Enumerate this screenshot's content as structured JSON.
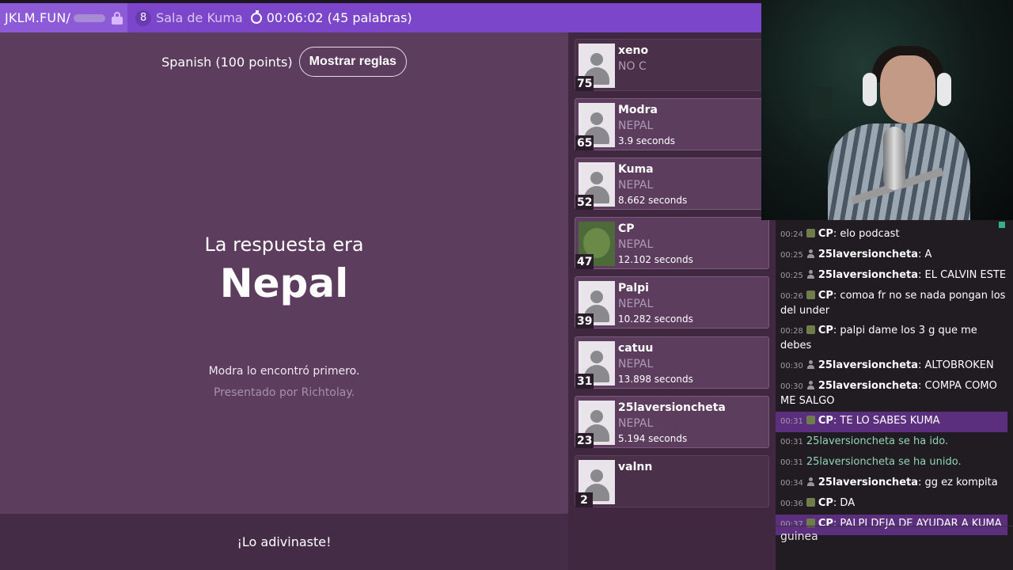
{
  "topbar": {
    "site": "JKLM.FUN/",
    "room_count": "8",
    "room_name": "Sala de Kuma",
    "timer": "00:06:02 (45 palabras)"
  },
  "main": {
    "language": "Spanish (100 points)",
    "rules_button": "Mostrar reglas",
    "answer_label": "La respuesta era",
    "answer": "Nepal",
    "found_text": "Modra lo encontró primero.",
    "presented_text": "Presentado por Richtolay.",
    "bottom_text": "¡Lo adivinaste!"
  },
  "players": [
    {
      "name": "xeno",
      "answer": "NO C",
      "time": "",
      "score": "75"
    },
    {
      "name": "Modra",
      "answer": "NEPAL",
      "time": "3.9 seconds",
      "score": "65"
    },
    {
      "name": "Kuma",
      "answer": "NEPAL",
      "time": "8.662 seconds",
      "score": "52"
    },
    {
      "name": "CP",
      "answer": "NEPAL",
      "time": "12.102 seconds",
      "score": "47"
    },
    {
      "name": "Palpi",
      "answer": "NEPAL",
      "time": "10.282 seconds",
      "score": "39"
    },
    {
      "name": "catuu",
      "answer": "NEPAL",
      "time": "13.898 seconds",
      "score": "31"
    },
    {
      "name": "25laversioncheta",
      "answer": "NEPAL",
      "time": "5.194 seconds",
      "score": "23"
    },
    {
      "name": "valnn",
      "answer": "",
      "time": "",
      "score": "2"
    }
  ],
  "chat": {
    "messages": [
      {
        "time": "00:24",
        "icon": "avatar-pic",
        "author": "CP",
        "text": ": elo podcast"
      },
      {
        "time": "00:25",
        "icon": "user-icon",
        "author": "25laversioncheta",
        "text": ": A"
      },
      {
        "time": "00:25",
        "icon": "user-icon",
        "author": "25laversioncheta",
        "text": ": EL CALVIN ESTE"
      },
      {
        "time": "00:26",
        "icon": "avatar-pic",
        "author": "CP",
        "text": ": comoa fr no se nada pongan los del under"
      },
      {
        "time": "00:28",
        "icon": "avatar-pic",
        "author": "CP",
        "text": ": palpi dame los 3 g que me debes"
      },
      {
        "time": "00:30",
        "icon": "user-icon",
        "author": "25laversioncheta",
        "text": ": ALTOBROKEN"
      },
      {
        "time": "00:30",
        "icon": "user-icon",
        "author": "25laversioncheta",
        "text": ": COMPA COMO ME SALGO"
      },
      {
        "time": "00:31",
        "icon": "avatar-pic",
        "author": "CP",
        "text": ": TE LO SABES KUMA"
      },
      {
        "time": "00:31",
        "system": "25laversioncheta se ha ido."
      },
      {
        "time": "00:31",
        "system": "25laversioncheta se ha unido."
      },
      {
        "time": "00:34",
        "icon": "user-icon",
        "author": "25laversioncheta",
        "text": ": gg ez kompita"
      },
      {
        "time": "00:36",
        "icon": "avatar-pic",
        "author": "CP",
        "text": ": DA"
      },
      {
        "time": "00:37",
        "icon": "avatar-pic",
        "author": "CP",
        "text": ": PALPI DEJA DE AYUDAR A KUMA"
      }
    ],
    "input_value": "guinea",
    "highlight_color": "#5b2f7e"
  },
  "colors": {
    "topbar": "#7b46c9",
    "main_bg": "#5c3d5e",
    "players_bg": "#3f2840",
    "system_msg": "#8fd6b2"
  }
}
